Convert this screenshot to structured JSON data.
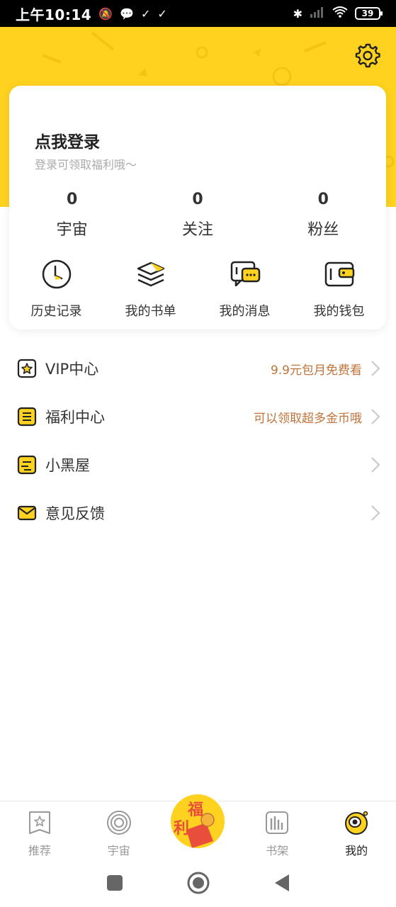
{
  "status_bar": {
    "time": "上午10:14",
    "battery": "39",
    "icons": [
      "mute-icon",
      "chat-bubble-icon",
      "check-icon",
      "check-icon",
      "bluetooth-icon",
      "signal-icon",
      "wifi-icon",
      "battery-icon"
    ]
  },
  "profile": {
    "login_title": "点我登录",
    "login_subtitle": "登录可领取福利哦～",
    "stats": [
      {
        "value": "0",
        "label": "宇宙"
      },
      {
        "value": "0",
        "label": "关注"
      },
      {
        "value": "0",
        "label": "粉丝"
      }
    ],
    "quick_actions": [
      {
        "label": "历史记录",
        "icon": "history-clock-icon"
      },
      {
        "label": "我的书单",
        "icon": "book-stack-icon"
      },
      {
        "label": "我的消息",
        "icon": "message-icon"
      },
      {
        "label": "我的钱包",
        "icon": "wallet-icon"
      }
    ]
  },
  "menu": [
    {
      "label": "VIP中心",
      "hint": "9.9元包月免费看",
      "icon": "vip-star-icon"
    },
    {
      "label": "福利中心",
      "hint": "可以领取超多金币哦",
      "icon": "welfare-list-icon"
    },
    {
      "label": "小黑屋",
      "hint": "",
      "icon": "blacklist-icon"
    },
    {
      "label": "意见反馈",
      "hint": "",
      "icon": "feedback-mail-icon"
    }
  ],
  "tabbar": {
    "tabs": [
      {
        "label": "推荐",
        "icon": "recommend-star-icon",
        "active": false
      },
      {
        "label": "宇宙",
        "icon": "universe-planet-icon",
        "active": false
      },
      {
        "label": "书架",
        "icon": "bookshelf-icon",
        "active": false
      },
      {
        "label": "我的",
        "icon": "me-avatar-icon",
        "active": true
      }
    ],
    "center": {
      "line1": "福",
      "line2": "利"
    }
  },
  "colors": {
    "brand_yellow": "#ffd21f",
    "hint_orange": "#c0733a",
    "fuli_red": "#e94d3b"
  }
}
